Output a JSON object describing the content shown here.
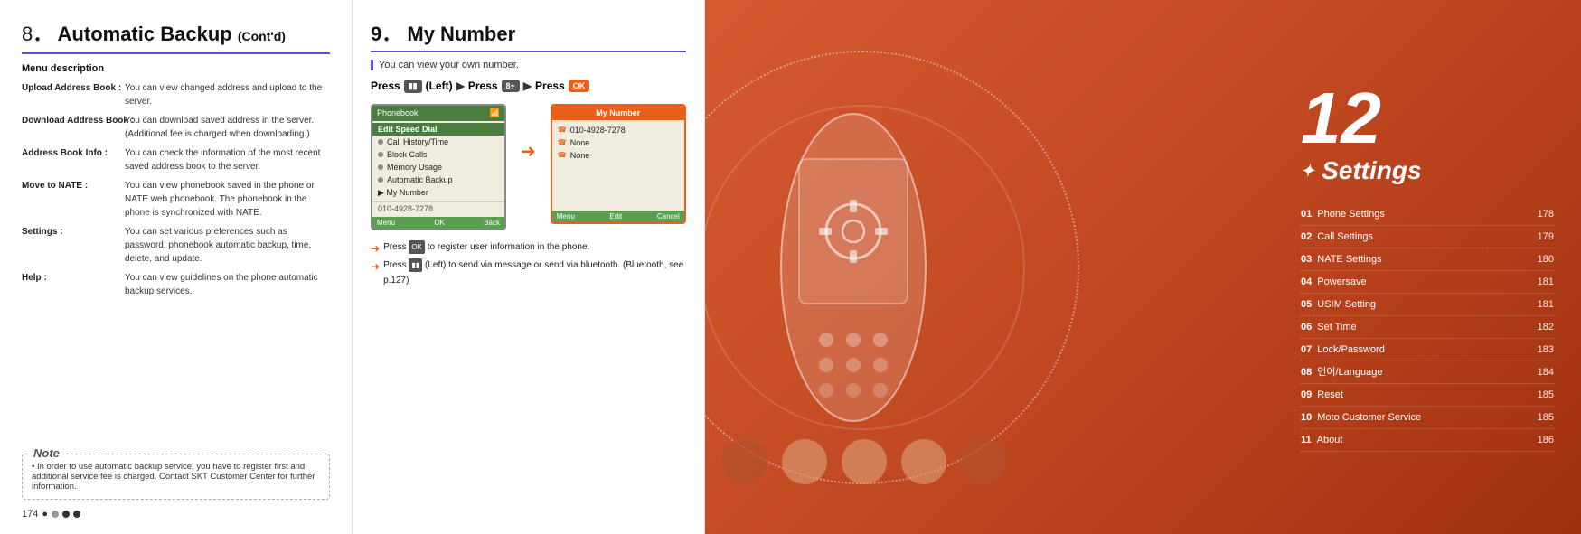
{
  "left": {
    "section_num": "8",
    "title": "Automatic Backup",
    "contd": "(Cont'd)",
    "divider_color": "#5a4fcf",
    "menu_desc_label": "Menu description",
    "menu_items": [
      {
        "key": "Upload Address Book :",
        "val": "You can view changed address and upload to the server."
      },
      {
        "key": "Download Address Book :",
        "val": "You can download saved address in the server. (Additional fee is charged when downloading.)"
      },
      {
        "key": "Address Book Info :",
        "val": "You can check the information of the most recent saved address book to the server."
      },
      {
        "key": "Move to NATE :",
        "val": "You can view phonebook saved in the phone or NATE web phonebook. The phonebook in the phone is synchronized with NATE."
      },
      {
        "key": "Settings :",
        "val": "You can set various preferences such as password, phonebook automatic backup, time, delete, and update."
      },
      {
        "key": "Help :",
        "val": "You can view guidelines on the phone automatic backup services."
      }
    ],
    "note_label": "Note",
    "note_text": "• In order to use automatic backup service, you have to register first and additional service fee is charged.  Contact SKT Customer Center for further information.",
    "page_number": "174",
    "dots": [
      "inactive",
      "active",
      "active"
    ]
  },
  "mid": {
    "section_num": "9",
    "title": "My Number",
    "subtitle": "You can view your own number.",
    "press_label": "Press",
    "left_btn": "(Left)",
    "press2": "Press",
    "press3": "Press",
    "screen1": {
      "header": "Phonebook",
      "items": [
        {
          "label": "Edit Speed Dial",
          "selected": true
        },
        {
          "label": "Call History/Time",
          "selected": false
        },
        {
          "label": "Block Calls",
          "selected": false
        },
        {
          "label": "Memory Usage",
          "selected": false
        },
        {
          "label": "Automatic Backup",
          "selected": false
        },
        {
          "label": "▶ My Number",
          "selected": false
        }
      ],
      "bottom_item": "010-4928-7278",
      "footer": [
        "Menu",
        "OK",
        "Back"
      ]
    },
    "screen2": {
      "header": "My Number",
      "items": [
        {
          "label": "010-4928-7278"
        },
        {
          "label": "None"
        },
        {
          "label": "None"
        }
      ],
      "footer": [
        "Menu",
        "Edit",
        "Cancel"
      ]
    },
    "tip1": "Press    to register user information in the phone.",
    "tip2": "Press    (Left) to send via message or send via bluetooth. (Bluetooth, see p.127)"
  },
  "right": {
    "chapter_num": "12",
    "chapter_title": "Settings",
    "toc": [
      {
        "num": "01",
        "label": "Phone Settings",
        "page": "178"
      },
      {
        "num": "02",
        "label": "Call Settings",
        "page": "179"
      },
      {
        "num": "03",
        "label": "NATE Settings",
        "page": "180"
      },
      {
        "num": "04",
        "label": "Powersave",
        "page": "181"
      },
      {
        "num": "05",
        "label": "USIM Setting",
        "page": "181"
      },
      {
        "num": "06",
        "label": "Set Time",
        "page": "182"
      },
      {
        "num": "07",
        "label": "Lock/Password",
        "page": "183"
      },
      {
        "num": "08",
        "label": "언어/Language",
        "page": "184"
      },
      {
        "num": "09",
        "label": "Reset",
        "page": "185"
      },
      {
        "num": "10",
        "label": "Moto Customer Service",
        "page": "185"
      },
      {
        "num": "11",
        "label": "About",
        "page": "186"
      }
    ]
  }
}
